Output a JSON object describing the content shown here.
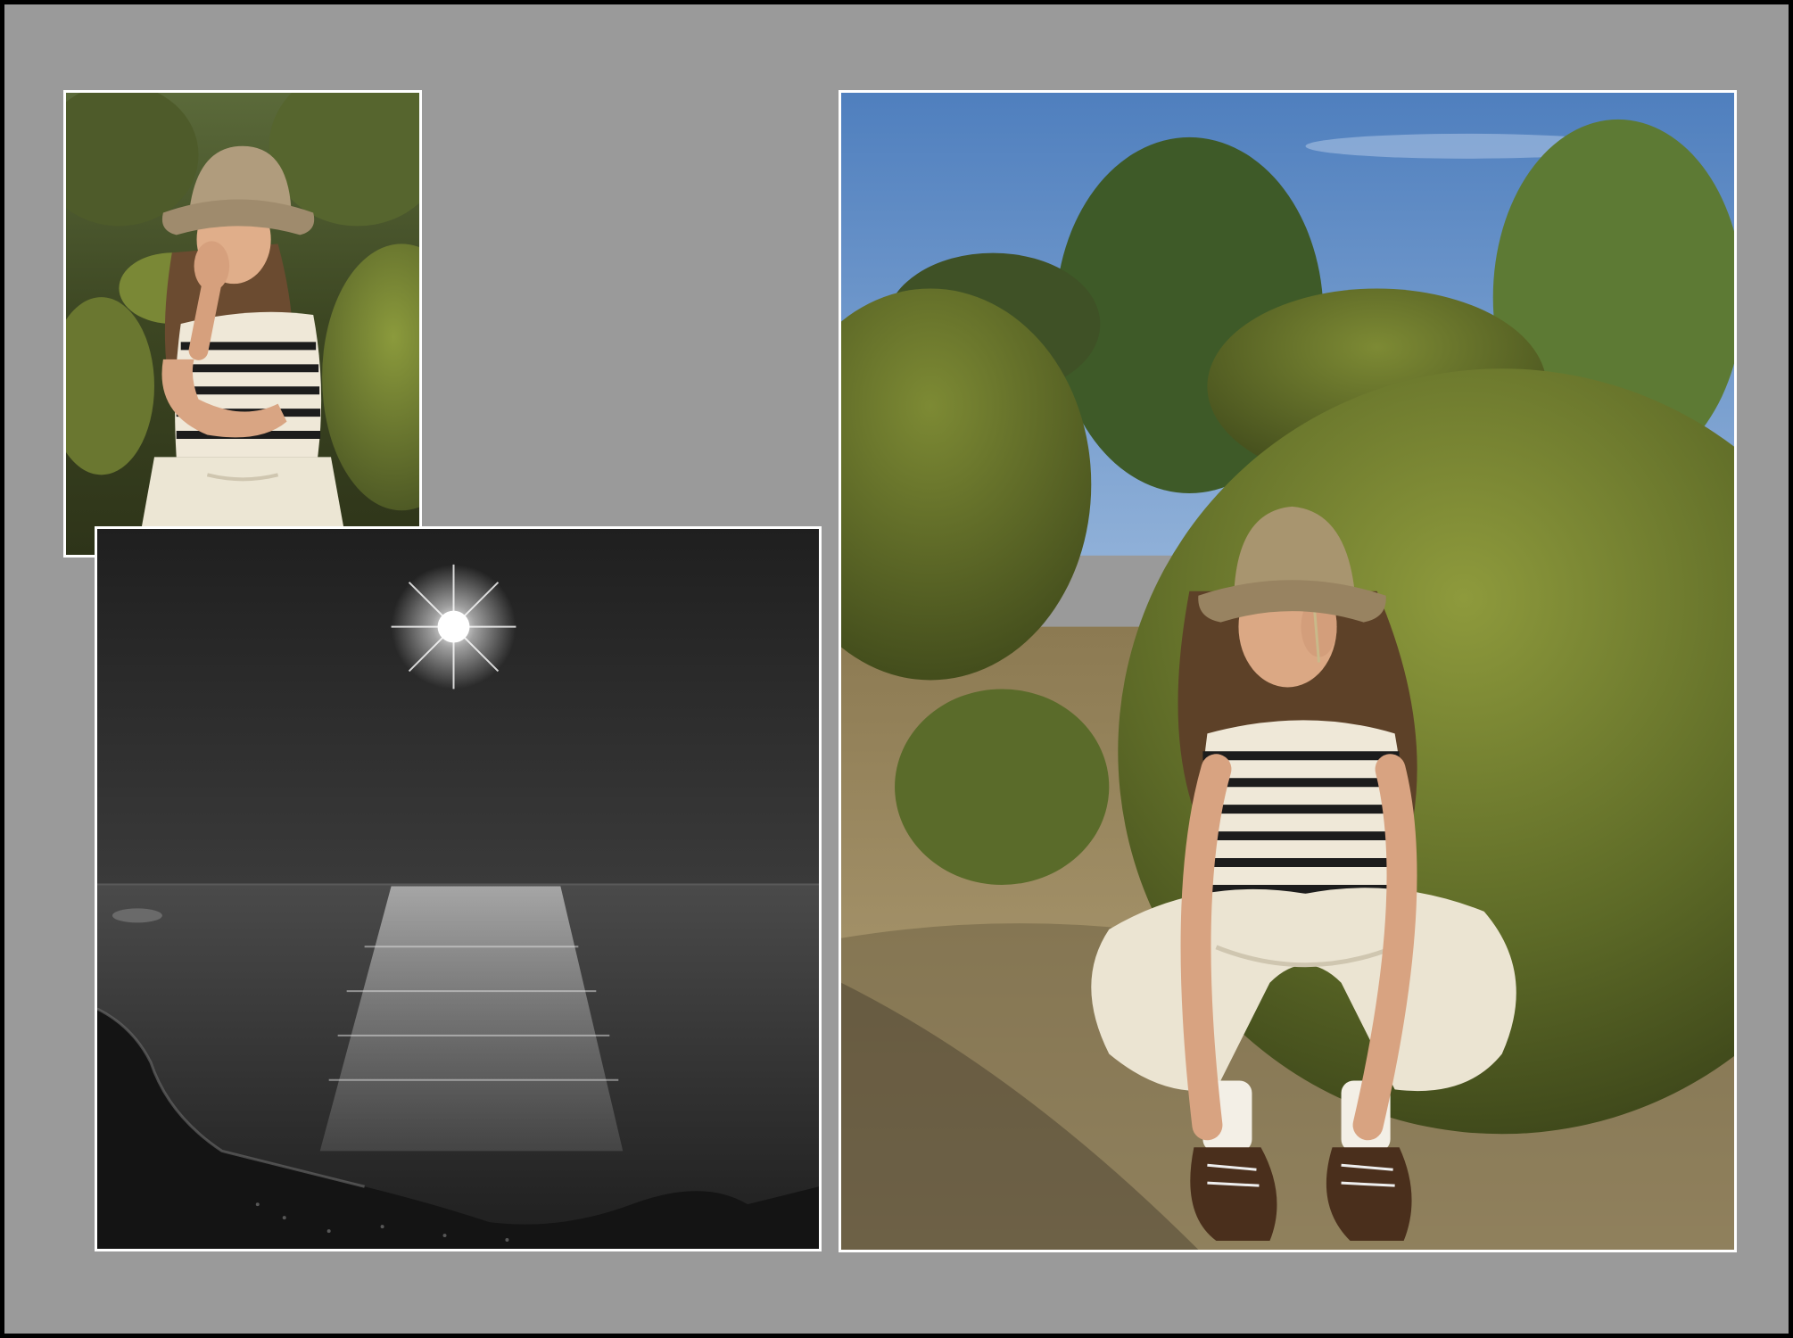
{
  "collage": {
    "background_color": "#9a9a9a",
    "outer_border_color": "#000000",
    "frame_color": "#ffffff",
    "photos": [
      {
        "name": "small-portrait",
        "subject": "woman-in-bucket-hat-laughing"
      },
      {
        "name": "moon-over-ocean",
        "subject": "black-and-white-moonlit-sea"
      },
      {
        "name": "large-portrait",
        "subject": "woman-seated-by-hedges"
      }
    ]
  },
  "palette": {
    "sky_blue": "#5f8fc9",
    "foliage_dark": "#3f4a1f",
    "foliage_mid": "#6c7a2d",
    "hat_khaki": "#a89577",
    "trousers_cream": "#e8e1cf",
    "night_sky": "#262626",
    "moon": "#ffffff"
  }
}
